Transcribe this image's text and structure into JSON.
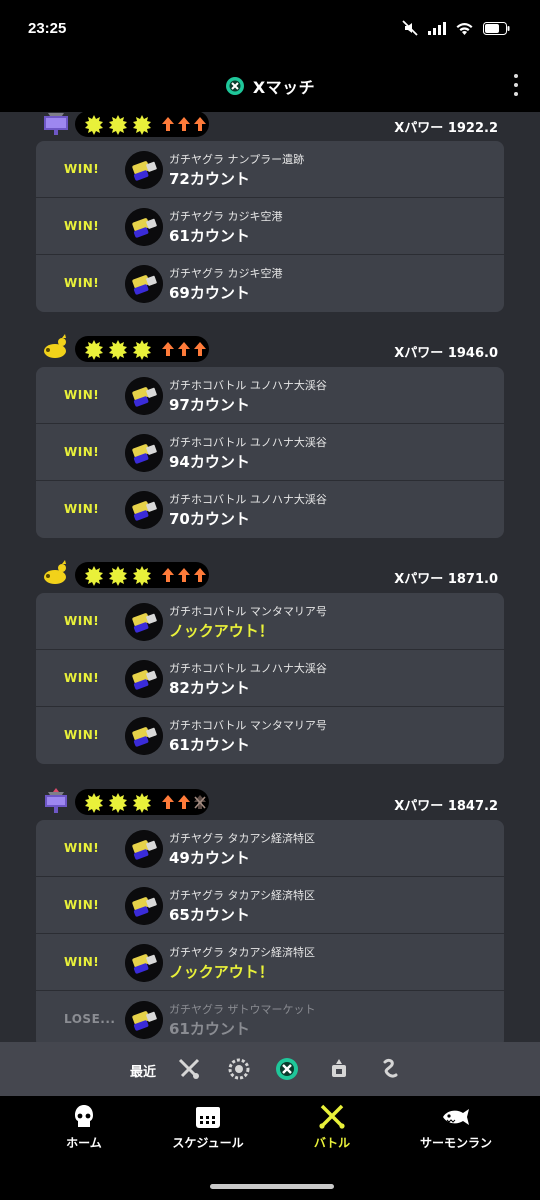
{
  "status_bar": {
    "time": "23:25"
  },
  "header": {
    "title": "Xマッチ"
  },
  "groups": [
    {
      "mode": "ガチヤグラ",
      "mode_icon": "tower-control-icon",
      "xpower": "Xパワー 1922.2",
      "record": [
        "win",
        "win",
        "win"
      ],
      "battles": [
        {
          "result": "WIN!",
          "stage": "ガチヤグラ ナンプラー遺跡",
          "score": "72カウント",
          "outcome": "win"
        },
        {
          "result": "WIN!",
          "stage": "ガチヤグラ カジキ空港",
          "score": "61カウント",
          "outcome": "win"
        },
        {
          "result": "WIN!",
          "stage": "ガチヤグラ カジキ空港",
          "score": "69カウント",
          "outcome": "win"
        }
      ]
    },
    {
      "mode": "ガチホコバトル",
      "mode_icon": "rainmaker-icon",
      "xpower": "Xパワー 1946.0",
      "record": [
        "win",
        "win",
        "win"
      ],
      "battles": [
        {
          "result": "WIN!",
          "stage": "ガチホコバトル ユノハナ大渓谷",
          "score": "97カウント",
          "outcome": "win"
        },
        {
          "result": "WIN!",
          "stage": "ガチホコバトル ユノハナ大渓谷",
          "score": "94カウント",
          "outcome": "win"
        },
        {
          "result": "WIN!",
          "stage": "ガチホコバトル ユノハナ大渓谷",
          "score": "70カウント",
          "outcome": "win"
        }
      ]
    },
    {
      "mode": "ガチホコバトル",
      "mode_icon": "rainmaker-icon",
      "xpower": "Xパワー 1871.0",
      "record": [
        "win",
        "win",
        "win"
      ],
      "battles": [
        {
          "result": "WIN!",
          "stage": "ガチホコバトル マンタマリア号",
          "score": "ノックアウト！",
          "outcome": "win",
          "knockout": true
        },
        {
          "result": "WIN!",
          "stage": "ガチホコバトル ユノハナ大渓谷",
          "score": "82カウント",
          "outcome": "win"
        },
        {
          "result": "WIN!",
          "stage": "ガチホコバトル マンタマリア号",
          "score": "61カウント",
          "outcome": "win"
        }
      ]
    },
    {
      "mode": "ガチヤグラ",
      "mode_icon": "tower-control-icon",
      "xpower": "Xパワー 1847.2",
      "record": [
        "win",
        "win",
        "lose"
      ],
      "battles": [
        {
          "result": "WIN!",
          "stage": "ガチヤグラ タカアシ経済特区",
          "score": "49カウント",
          "outcome": "win"
        },
        {
          "result": "WIN!",
          "stage": "ガチヤグラ タカアシ経済特区",
          "score": "65カウント",
          "outcome": "win"
        },
        {
          "result": "WIN!",
          "stage": "ガチヤグラ タカアシ経済特区",
          "score": "ノックアウト！",
          "outcome": "win",
          "knockout": true
        },
        {
          "result": "LOSE...",
          "stage": "ガチヤグラ ザトウマーケット",
          "score": "61カウント",
          "outcome": "lose"
        }
      ]
    }
  ],
  "filter_bar": {
    "label": "最近",
    "filters": [
      "regular-battle-icon",
      "bankara-battle-icon",
      "x-battle-icon",
      "event-battle-icon",
      "private-battle-icon"
    ],
    "selected": "x-battle-icon"
  },
  "bottom_nav": {
    "items": [
      {
        "label": "ホーム",
        "icon": "home-squid-icon"
      },
      {
        "label": "スケジュール",
        "icon": "schedule-icon"
      },
      {
        "label": "バトル",
        "icon": "battle-icon",
        "active": true
      },
      {
        "label": "サーモンラン",
        "icon": "salmon-run-icon"
      }
    ]
  },
  "colors": {
    "accent": "#e9f13a",
    "card": "#3e4149",
    "background": "#2b2d33",
    "arrow": "#ff7b3a"
  }
}
